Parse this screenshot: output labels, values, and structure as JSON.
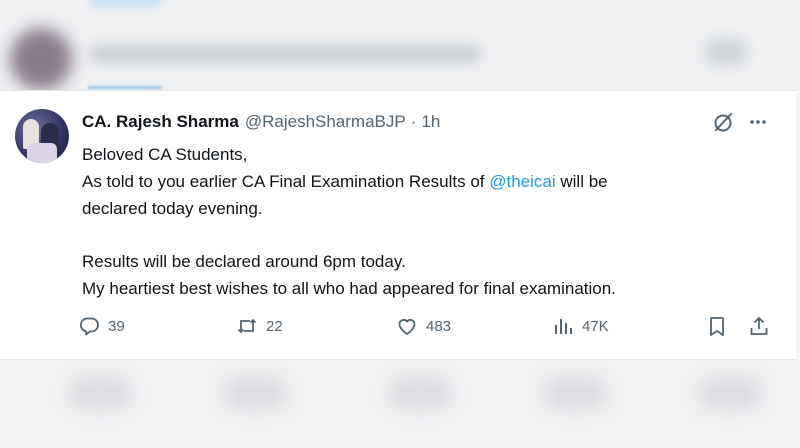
{
  "tweet": {
    "author_name": "CA. Rajesh Sharma",
    "handle": "@RajeshSharmaBJP",
    "separator": "·",
    "time": "1h",
    "line1": "Beloved CA Students,",
    "line2_pre": "As told to you earlier CA Final Examination Results of ",
    "mention": "@theicai",
    "line2_post": " will be",
    "line3": "declared today evening.",
    "line4": "Results will be declared around 6pm today.",
    "line5": "My heartiest best wishes to all who had appeared for final examination."
  },
  "actions": {
    "replies": "39",
    "reposts": "22",
    "likes": "483",
    "views": "47K"
  },
  "icons": {
    "grok": "grok-icon",
    "more": "more-icon",
    "reply": "reply-icon",
    "repost": "repost-icon",
    "like": "like-icon",
    "views": "views-icon",
    "bookmark": "bookmark-icon",
    "share": "share-icon"
  },
  "colors": {
    "mention": "#1d9bf0",
    "secondary_text": "#536471"
  }
}
